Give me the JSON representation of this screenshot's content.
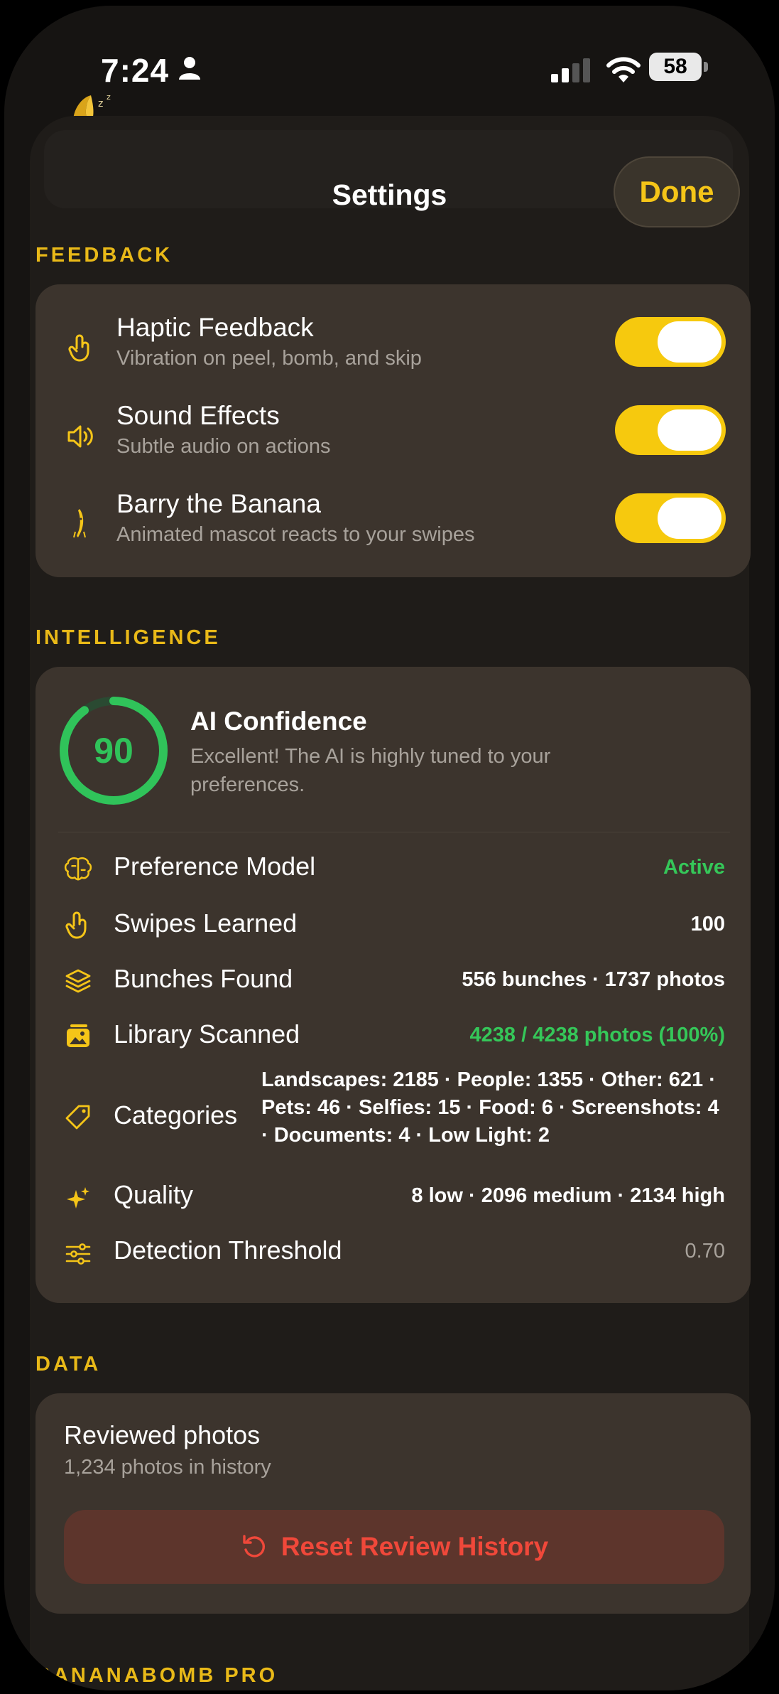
{
  "status_bar": {
    "time": "7:24",
    "battery": "58",
    "icons": [
      "person-icon",
      "cellular-signal-icon",
      "wifi-icon",
      "battery-icon"
    ]
  },
  "sheet": {
    "title": "Settings",
    "done_label": "Done"
  },
  "colors": {
    "accent": "#f5c518",
    "toggle_on": "#f6c90e",
    "green": "#35c759",
    "destructive": "#f0483a",
    "card": "#3c342d",
    "sheet": "#1f1c19"
  },
  "feedback": {
    "header": "FEEDBACK",
    "items": [
      {
        "icon": "tap-hand-icon",
        "title": "Haptic Feedback",
        "subtitle": "Vibration on peel, bomb, and skip",
        "enabled": true
      },
      {
        "icon": "speaker-icon",
        "title": "Sound Effects",
        "subtitle": "Subtle audio on actions",
        "enabled": true
      },
      {
        "icon": "banana-mascot-icon",
        "title": "Barry the Banana",
        "subtitle": "Animated mascot reacts to your swipes",
        "enabled": true
      }
    ]
  },
  "intelligence": {
    "header": "INTELLIGENCE",
    "confidence": {
      "score": "90",
      "score_fraction": 0.9,
      "title": "AI Confidence",
      "description": "Excellent! The AI is highly tuned to your preferences."
    },
    "stats": [
      {
        "icon": "brain-icon",
        "label": "Preference Model",
        "value": "Active"
      },
      {
        "icon": "tap-hand-icon",
        "label": "Swipes Learned",
        "value": "100"
      },
      {
        "icon": "stack-icon",
        "label": "Bunches Found",
        "value": "556 bunches · 1737 photos"
      },
      {
        "icon": "photo-library-icon",
        "label": "Library Scanned",
        "value": "4238 / 4238 photos (100%)"
      },
      {
        "icon": "tag-icon",
        "label": "Categories",
        "value": "Landscapes: 2185 · People: 1355 · Other: 621 · Pets: 46 · Selfies: 15 · Food: 6 · Screenshots: 4 · Documents: 4 · Low Light: 2"
      },
      {
        "icon": "sparkles-icon",
        "label": "Quality",
        "value": "8 low · 2096 medium · 2134 high"
      },
      {
        "icon": "sliders-icon",
        "label": "Detection Threshold",
        "value": "0.70"
      }
    ]
  },
  "data_section": {
    "header": "DATA",
    "reviewed_title": "Reviewed photos",
    "reviewed_subtitle": "1,234 photos in history",
    "reset_label": "Reset Review History"
  },
  "pro": {
    "header": "BANANABOMB PRO"
  }
}
